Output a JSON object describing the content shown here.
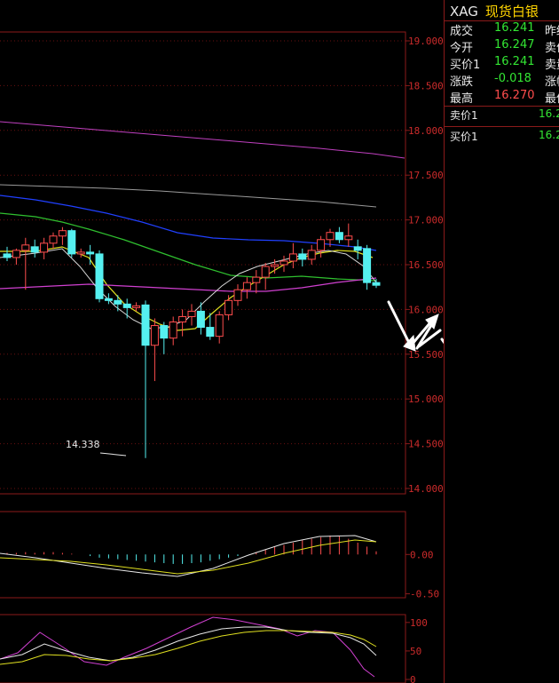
{
  "quote": {
    "symbol": "XAG",
    "name": "现货白银",
    "rows": [
      {
        "label": "成交",
        "value": "16.241",
        "label2": "昨结",
        "color": "green"
      },
      {
        "label": "今开",
        "value": "16.247",
        "label2": "卖价",
        "color": "green"
      },
      {
        "label": "买价1",
        "value": "16.241",
        "label2": "卖量",
        "color": "green"
      },
      {
        "label": "涨跌",
        "value": "-0.018",
        "label2": "涨幅",
        "color": "green"
      },
      {
        "label": "最高",
        "value": "16.270",
        "label2": "最低",
        "color": "red"
      }
    ],
    "ask_label": "卖价1",
    "ask_value": "16.2",
    "bid_label": "买价1",
    "bid_value": "16.2"
  },
  "chart_data": {
    "type": "candlestick",
    "price_ticks": [
      "19.000",
      "18.500",
      "18.000",
      "17.500",
      "17.000",
      "16.500",
      "16.000",
      "15.500",
      "15.000",
      "14.500",
      "14.000"
    ],
    "price_range": [
      14.0,
      19.0
    ],
    "low_annotation": "14.338",
    "candles": [
      [
        16.62,
        16.7,
        16.54,
        16.58
      ],
      [
        16.58,
        16.68,
        16.5,
        16.66
      ],
      [
        16.66,
        16.8,
        16.22,
        16.72
      ],
      [
        16.7,
        16.78,
        16.58,
        16.64
      ],
      [
        16.64,
        16.8,
        16.56,
        16.74
      ],
      [
        16.74,
        16.86,
        16.68,
        16.82
      ],
      [
        16.82,
        16.92,
        16.72,
        16.88
      ],
      [
        16.88,
        16.9,
        16.58,
        16.62
      ],
      [
        16.62,
        16.68,
        16.58,
        16.64
      ],
      [
        16.64,
        16.72,
        16.5,
        16.62
      ],
      [
        16.62,
        16.66,
        16.08,
        16.12
      ],
      [
        16.12,
        16.18,
        16.06,
        16.1
      ],
      [
        16.1,
        16.16,
        15.98,
        16.06
      ],
      [
        16.06,
        16.12,
        15.9,
        16.02
      ],
      [
        16.02,
        16.08,
        15.98,
        16.04
      ],
      [
        16.05,
        16.1,
        14.34,
        15.6
      ],
      [
        15.6,
        15.9,
        15.2,
        15.82
      ],
      [
        15.82,
        15.86,
        15.5,
        15.68
      ],
      [
        15.68,
        15.92,
        15.6,
        15.86
      ],
      [
        15.86,
        16.0,
        15.7,
        15.92
      ],
      [
        15.92,
        16.06,
        15.82,
        15.98
      ],
      [
        15.98,
        16.08,
        15.72,
        15.8
      ],
      [
        15.8,
        15.96,
        15.66,
        15.7
      ],
      [
        15.7,
        15.98,
        15.62,
        15.94
      ],
      [
        15.94,
        16.16,
        15.88,
        16.1
      ],
      [
        16.1,
        16.28,
        16.04,
        16.22
      ],
      [
        16.22,
        16.36,
        16.12,
        16.3
      ],
      [
        16.3,
        16.44,
        16.18,
        16.36
      ],
      [
        16.36,
        16.52,
        16.22,
        16.48
      ],
      [
        16.48,
        16.56,
        16.4,
        16.5
      ],
      [
        16.5,
        16.6,
        16.42,
        16.54
      ],
      [
        16.54,
        16.74,
        16.46,
        16.62
      ],
      [
        16.62,
        16.68,
        16.48,
        16.56
      ],
      [
        16.56,
        16.72,
        16.5,
        16.66
      ],
      [
        16.66,
        16.82,
        16.58,
        16.78
      ],
      [
        16.78,
        16.9,
        16.7,
        16.86
      ],
      [
        16.86,
        16.92,
        16.74,
        16.78
      ],
      [
        16.78,
        16.96,
        16.7,
        16.82
      ],
      [
        16.7,
        16.78,
        16.56,
        16.66
      ],
      [
        16.68,
        16.72,
        16.22,
        16.3
      ],
      [
        16.3,
        16.34,
        16.24,
        16.27
      ]
    ],
    "macd_ticks": [
      "0.00",
      "-0.50"
    ],
    "macd_range": [
      -0.55,
      0.5
    ],
    "macd_hist": [
      0.02,
      0.02,
      0.03,
      0.02,
      0.03,
      0.03,
      0.02,
      0.01,
      0.0,
      -0.02,
      -0.04,
      -0.05,
      -0.06,
      -0.07,
      -0.08,
      -0.09,
      -0.1,
      -0.11,
      -0.12,
      -0.12,
      -0.11,
      -0.1,
      -0.08,
      -0.06,
      -0.04,
      -0.02,
      0.0,
      0.03,
      0.06,
      0.1,
      0.12,
      0.15,
      0.18,
      0.2,
      0.22,
      0.24,
      0.23,
      0.2,
      0.15,
      0.1,
      0.04
    ],
    "kdj_ticks": [
      "100",
      "50",
      "0"
    ],
    "kdj_range": [
      0,
      120
    ]
  }
}
